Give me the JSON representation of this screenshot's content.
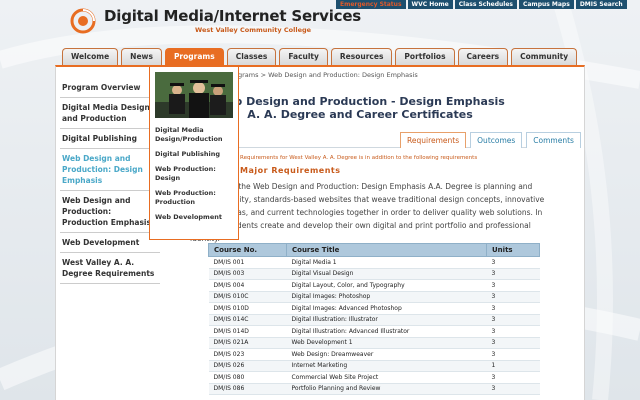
{
  "header": {
    "title": "Digital Media/Internet Services",
    "subtitle": "West Valley Community College",
    "top_links": [
      "Emergency Status",
      "WVC Home",
      "Class Schedules",
      "Campus Maps",
      "DMIS Search"
    ]
  },
  "nav": {
    "tabs": [
      "Welcome",
      "News",
      "Programs",
      "Classes",
      "Faculty",
      "Resources",
      "Portfolios",
      "Careers",
      "Community"
    ],
    "active": "Programs"
  },
  "sidebar": {
    "items": [
      "Program Overview",
      "Digital Media Design and Production",
      "Digital Publishing",
      "Web Design and Production: Design Emphasis",
      "Web Design and Production: Production Emphasis",
      "Web Development",
      "West Valley A. A. Degree Requirements"
    ],
    "active_index": 3
  },
  "dropdown": {
    "items": [
      "Digital Media Design/Production",
      "Digital Publishing",
      "Web Production: Design",
      "Web Production: Production",
      "Web Development"
    ]
  },
  "content": {
    "breadcrumb": "grams > Web Design and Production: Design Emphasis",
    "title_line1": "Web Design and Production - Design Emphasis",
    "title_line2": "A. A. Degree and Career Certificates",
    "tabs": [
      "Requirements",
      "Outcomes",
      "Comments"
    ],
    "active_tab": "Requirements",
    "req_note": "Requirements for West Valley A. A. Degree is in addition to the following requirements",
    "req_heading": "Major Requirements",
    "description": "The focus of the Web Design and Production: Design Emphasis A.A. Degree is planning and creating quality, standards-based websites that weave traditional design concepts, innovative interface ideas, and current technologies together in order to deliver quality web solutions. In addition, students create and develop their own digital and print portfolio and professional identity."
  },
  "table": {
    "headers": [
      "Course No.",
      "Course Title",
      "Units"
    ],
    "rows": [
      [
        "DM/IS 001",
        "Digital Media 1",
        "3"
      ],
      [
        "DM/IS 003",
        "Digital Visual Design",
        "3"
      ],
      [
        "DM/IS 004",
        "Digital Layout, Color, and Typography",
        "3"
      ],
      [
        "DM/IS 010C",
        "Digital Images: Photoshop",
        "3"
      ],
      [
        "DM/IS 010D",
        "Digital Images: Advanced Photoshop",
        "3"
      ],
      [
        "DM/IS 014C",
        "Digital Illustration: Illustrator",
        "3"
      ],
      [
        "DM/IS 014D",
        "Digital Illustration: Advanced Illustrator",
        "3"
      ],
      [
        "DM/IS 021A",
        "Web Development 1",
        "3"
      ],
      [
        "DM/IS 023",
        "Web Design: Dreamweaver",
        "3"
      ],
      [
        "DM/IS 026",
        "Internet Marketing",
        "1"
      ],
      [
        "DM/IS 080",
        "Commercial Web Site Project",
        "3"
      ],
      [
        "DM/IS 086",
        "Portfolio Planning and Review",
        "3"
      ]
    ]
  },
  "colors": {
    "accent": "#e86d22",
    "link_blue": "#2a7ea6",
    "table_header": "#aec8dc",
    "top_bar": "#1d4f6e"
  }
}
